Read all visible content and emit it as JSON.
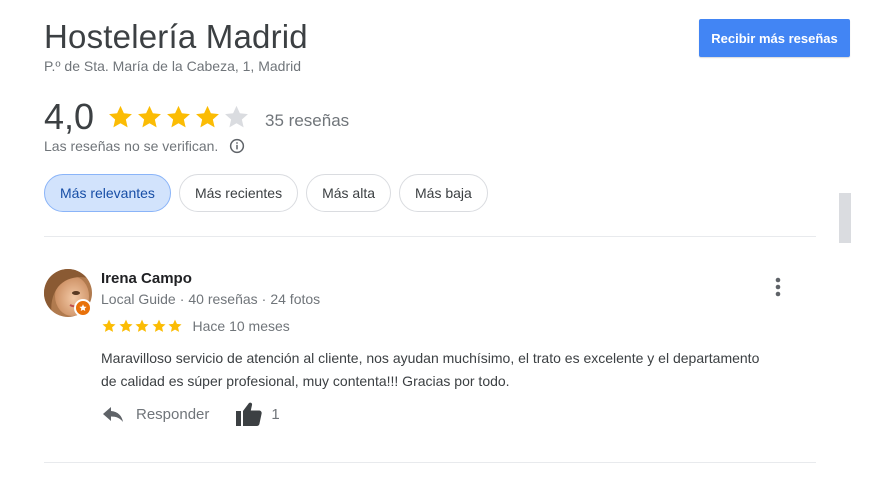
{
  "business": {
    "name": "Hostelería Madrid",
    "address": "P.º de Sta. María de la Cabeza, 1, Madrid",
    "rating": "4,0",
    "rating_value": 4.0,
    "review_count": "35 reseñas",
    "disclaimer": "Las reseñas no se verifican."
  },
  "cta": {
    "label": "Recibir más reseñas",
    "color": "#4285f4"
  },
  "filters": [
    {
      "label": "Más relevantes",
      "active": true
    },
    {
      "label": "Más recientes",
      "active": false
    },
    {
      "label": "Más alta",
      "active": false
    },
    {
      "label": "Más baja",
      "active": false
    }
  ],
  "review": {
    "author": "Irena Campo",
    "badge": "Local Guide",
    "author_reviews": "40 reseñas",
    "author_photos": "24 fotos",
    "meta_separator": "·",
    "stars": 5,
    "date": "Hace 10 meses",
    "text": "Maravilloso servicio de atención al cliente, nos ayudan muchísimo, el trato es excelente y el departamento de calidad es súper profesional, muy contenta!!! Gracias por todo.",
    "reply_label": "Responder",
    "likes": "1"
  },
  "icons": {
    "star": "star-icon",
    "info": "info-icon",
    "more": "more-vert-icon",
    "reply": "reply-icon",
    "like": "thumb-up-icon",
    "guide_badge": "local-guide-badge-icon"
  },
  "colors": {
    "star_filled": "#fbbc04",
    "star_empty": "#dadce0",
    "chip_active_bg": "#d2e3fc",
    "guide_badge": "#e8710a"
  }
}
